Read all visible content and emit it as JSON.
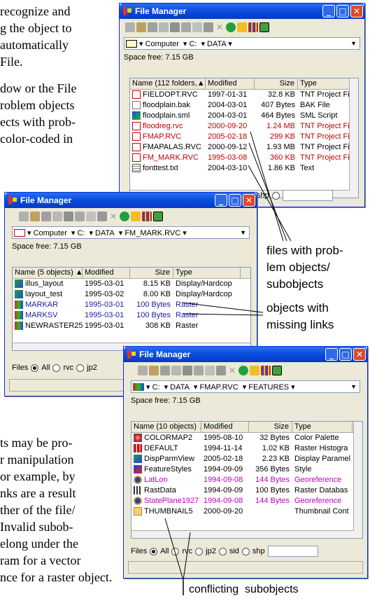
{
  "left_text": {
    "top_lines": [
      " recognize and",
      "g the object to",
      " automatically",
      "File.",
      "",
      "dow or the File",
      "roblem objects",
      "ects with prob-",
      "color-coded in"
    ],
    "bottom_lines": [
      "ts may be pro-",
      "r manipulation",
      "or example, by",
      "nks are a result",
      "ther of the file/",
      " Invalid subob-",
      "elong under the",
      "ram for a vector",
      "nce for a raster object."
    ]
  },
  "windows": [
    {
      "title": "File Manager",
      "path": [
        "Computer",
        "C:",
        "DATA"
      ],
      "space": "Space free: 7.15 GB",
      "columns": [
        "Name (112 folders,▲",
        "Modified",
        "Size",
        "Type"
      ],
      "rows": [
        {
          "name": "FIELDOPT.RVC",
          "date": "1997-01-31",
          "size": "32.8 KB",
          "type": "TNT Project File",
          "color": "black",
          "icon": "rvc-icon"
        },
        {
          "name": "floodplain.bak",
          "date": "2004-03-01",
          "size": "407 Bytes",
          "type": "BAK File",
          "color": "black",
          "icon": "file-icon"
        },
        {
          "name": "floodplain.sml",
          "date": "2004-03-01",
          "size": "464 Bytes",
          "type": "SML Script",
          "color": "black",
          "icon": "script-icon"
        },
        {
          "name": "floodreg.rvc",
          "date": "2000-09-20",
          "size": "1.24 MB",
          "type": "TNT Project File",
          "color": "red",
          "icon": "rvc-icon"
        },
        {
          "name": "FMAP.RVC",
          "date": "2005-02-18",
          "size": "299 KB",
          "type": "TNT Project File",
          "color": "red",
          "icon": "rvc-icon"
        },
        {
          "name": "FMAPALAS.RVC",
          "date": "2000-09-12",
          "size": "1.93 MB",
          "type": "TNT Project File",
          "color": "black",
          "icon": "rvc-icon"
        },
        {
          "name": "FM_MARK.RVC",
          "date": "1995-03-08",
          "size": "360 KB",
          "type": "TNT Project File",
          "color": "red",
          "icon": "rvc-icon"
        },
        {
          "name": "fonttest.txt",
          "date": "2004-03-10",
          "size": "1.86 KB",
          "type": "Text",
          "color": "black",
          "icon": "text-icon"
        }
      ],
      "filters_tail": [
        "shp"
      ]
    },
    {
      "title": "File Manager",
      "path": [
        "Computer",
        "C:",
        "DATA",
        "FM_MARK.RVC"
      ],
      "space": "Space free: 7.15 GB",
      "columns": [
        "Name (5 objects) ▲",
        "Modified",
        "Size",
        "Type"
      ],
      "rows": [
        {
          "name": "illus_layout",
          "date": "1995-03-01",
          "size": "8.15 KB",
          "type": "Display/Hardcop",
          "color": "black",
          "icon": "layout-icon"
        },
        {
          "name": "layout_test",
          "date": "1995-03-02",
          "size": "8.00 KB",
          "type": "Display/Hardcop",
          "color": "black",
          "icon": "layout-icon"
        },
        {
          "name": "MARKAR",
          "date": "1995-03-01",
          "size": "100 Bytes",
          "type": "Raster",
          "color": "blue",
          "icon": "raster-icon"
        },
        {
          "name": "MARKSV",
          "date": "1995-03-01",
          "size": "100 Bytes",
          "type": "Raster",
          "color": "blue",
          "icon": "raster-icon"
        },
        {
          "name": "NEWRASTER255",
          "date": "1995-03-01",
          "size": "308 KB",
          "type": "Raster",
          "color": "black",
          "icon": "raster-icon"
        }
      ],
      "filters": [
        "Files",
        "All",
        "rvc",
        "jp2"
      ]
    },
    {
      "title": "File Manager",
      "path": [
        "C:",
        "DATA",
        "FMAP.RVC",
        "FEATURES"
      ],
      "space": "Space free: 7.15 GB",
      "columns": [
        "Name (10 objects) ▲",
        "Modified",
        "Size",
        "Type"
      ],
      "rows": [
        {
          "name": "COLORMAP2",
          "date": "1995-08-10",
          "size": "32 Bytes",
          "type": "Color Palette",
          "color": "black",
          "icon": "palette-icon"
        },
        {
          "name": "DEFAULT",
          "date": "1994-11-14",
          "size": "1.02 KB",
          "type": "Raster Histogra",
          "color": "black",
          "icon": "histogram-icon"
        },
        {
          "name": "DispParmView",
          "date": "2005-02-18",
          "size": "2.23 KB",
          "type": "Display Paramel",
          "color": "black",
          "icon": "display-icon"
        },
        {
          "name": "FeatureStyles",
          "date": "1994-09-09",
          "size": "356 Bytes",
          "type": "Style",
          "color": "black",
          "icon": "style-icon"
        },
        {
          "name": "LatLon",
          "date": "1994-09-08",
          "size": "144 Bytes",
          "type": "Georeference",
          "color": "magenta",
          "icon": "georef-icon"
        },
        {
          "name": "RastData",
          "date": "1994-09-09",
          "size": "100 Bytes",
          "type": "Raster Databas",
          "color": "black",
          "icon": "database-icon"
        },
        {
          "name": "StatePlane1927",
          "date": "1994-09-08",
          "size": "144 Bytes",
          "type": "Georeference",
          "color": "magenta",
          "icon": "georef-icon"
        },
        {
          "name": "THUMBNAIL5",
          "date": "2000-09-20",
          "size": "",
          "type": "Thumbnail Cont",
          "color": "black",
          "icon": "thumbnail-icon"
        }
      ],
      "filters": [
        "Files",
        "All",
        "rvc",
        "jp2",
        "sid",
        "shp"
      ]
    }
  ],
  "callouts": {
    "problem_files": [
      "files with prob-",
      "lem objects/",
      "subobjects"
    ],
    "missing_links": [
      "objects with",
      "missing links"
    ],
    "conflicting": "conflicting  subobjects"
  },
  "colors": {
    "red": "#c00000",
    "blue": "#1a1aa8",
    "magenta": "#c000c0",
    "titlebar": "#0a4ee0"
  }
}
